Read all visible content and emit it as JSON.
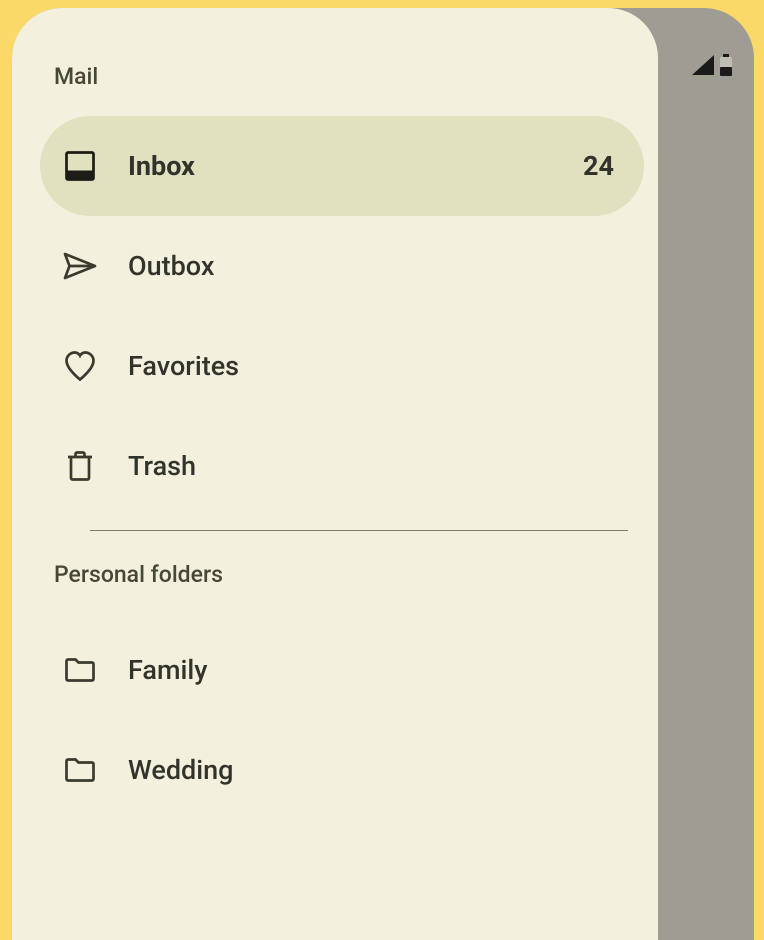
{
  "sections": {
    "mail": {
      "header": "Mail",
      "items": [
        {
          "label": "Inbox",
          "count": "24",
          "selected": true,
          "icon": "inbox"
        },
        {
          "label": "Outbox",
          "icon": "send"
        },
        {
          "label": "Favorites",
          "icon": "heart"
        },
        {
          "label": "Trash",
          "icon": "trash"
        }
      ]
    },
    "personal": {
      "header": "Personal folders",
      "items": [
        {
          "label": "Family",
          "icon": "folder"
        },
        {
          "label": "Wedding",
          "icon": "folder"
        }
      ]
    }
  }
}
